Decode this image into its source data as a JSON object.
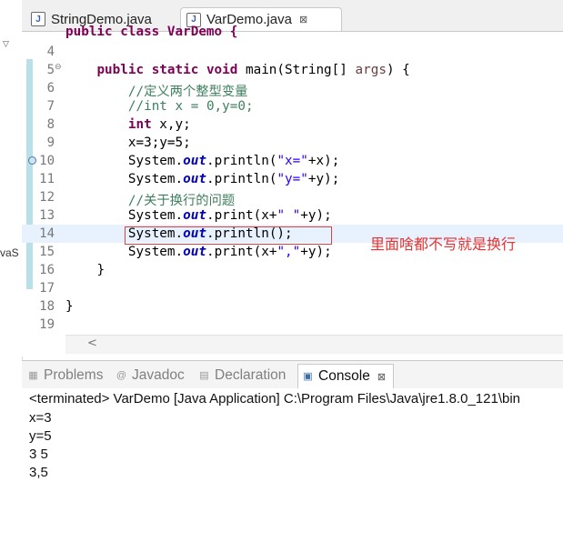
{
  "left_panel": {
    "fragment_text": "vaS"
  },
  "editor_tabs": [
    {
      "label": "StringDemo.java",
      "active": false
    },
    {
      "label": "VarDemo.java",
      "active": true,
      "close": "⊠"
    }
  ],
  "code": {
    "partial_top": "public class VarDemo {",
    "lines": [
      {
        "num": "4"
      },
      {
        "num": "5",
        "fold": "⊖"
      },
      {
        "num": "6"
      },
      {
        "num": "7"
      },
      {
        "num": "8"
      },
      {
        "num": "9"
      },
      {
        "num": "10",
        "marker": true
      },
      {
        "num": "11"
      },
      {
        "num": "12"
      },
      {
        "num": "13"
      },
      {
        "num": "14",
        "highlighted": true
      },
      {
        "num": "15"
      },
      {
        "num": "16"
      },
      {
        "num": "17"
      },
      {
        "num": "18"
      },
      {
        "num": "19"
      }
    ],
    "tokens": {
      "l5_kw": "public static void",
      "l5_rest": " main(String[] ",
      "l5_args": "args",
      "l5_end": ") {",
      "l6": "//定义两个整型变量",
      "l7": "//int x = 0,y=0;",
      "l8_kw": "int",
      "l8_rest": " x,y;",
      "l9": "x=3;y=5;",
      "sys": "System.",
      "out": "out",
      "l10_a": ".println(",
      "l10_s": "\"x=\"",
      "l10_b": "+x);",
      "l11_a": ".println(",
      "l11_s": "\"y=\"",
      "l11_b": "+y);",
      "l12": "//关于换行的问题",
      "l13_a": ".print(x+",
      "l13_s": "\" \"",
      "l13_b": "+y);",
      "l14_a": ".println();",
      "l15_a": ".print(x+",
      "l15_s": "\",\"",
      "l15_b": "+y);",
      "l16": "}",
      "l18": "}"
    }
  },
  "annotation": "里面啥都不写就是换行",
  "view_tabs": [
    {
      "label": "Problems",
      "icon": "problems-icon"
    },
    {
      "label": "Javadoc",
      "icon": "javadoc-icon"
    },
    {
      "label": "Declaration",
      "icon": "declaration-icon"
    },
    {
      "label": "Console",
      "icon": "console-icon",
      "active": true,
      "close": "⊠"
    }
  ],
  "console": {
    "terminated": "<terminated> VarDemo [Java Application] C:\\Program Files\\Java\\jre1.8.0_121\\bin",
    "output": [
      "x=3",
      "y=5",
      "3 5",
      "3,5"
    ]
  },
  "colors": {
    "keyword": "#7f0055",
    "comment": "#3f7f5f",
    "string": "#2a00ff",
    "field": "#0000c0",
    "annotation": "#e53333",
    "line_highlight": "#e8f2fe"
  }
}
